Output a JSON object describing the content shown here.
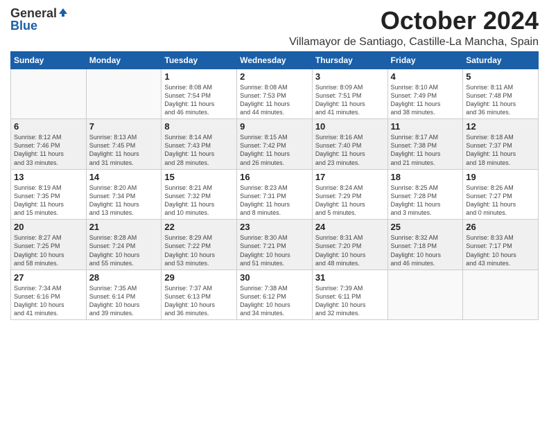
{
  "header": {
    "logo_general": "General",
    "logo_blue": "Blue",
    "month_title": "October 2024",
    "location": "Villamayor de Santiago, Castille-La Mancha, Spain"
  },
  "weekdays": [
    "Sunday",
    "Monday",
    "Tuesday",
    "Wednesday",
    "Thursday",
    "Friday",
    "Saturday"
  ],
  "weeks": [
    [
      {
        "day": "",
        "info": ""
      },
      {
        "day": "",
        "info": ""
      },
      {
        "day": "1",
        "info": "Sunrise: 8:08 AM\nSunset: 7:54 PM\nDaylight: 11 hours\nand 46 minutes."
      },
      {
        "day": "2",
        "info": "Sunrise: 8:08 AM\nSunset: 7:53 PM\nDaylight: 11 hours\nand 44 minutes."
      },
      {
        "day": "3",
        "info": "Sunrise: 8:09 AM\nSunset: 7:51 PM\nDaylight: 11 hours\nand 41 minutes."
      },
      {
        "day": "4",
        "info": "Sunrise: 8:10 AM\nSunset: 7:49 PM\nDaylight: 11 hours\nand 38 minutes."
      },
      {
        "day": "5",
        "info": "Sunrise: 8:11 AM\nSunset: 7:48 PM\nDaylight: 11 hours\nand 36 minutes."
      }
    ],
    [
      {
        "day": "6",
        "info": "Sunrise: 8:12 AM\nSunset: 7:46 PM\nDaylight: 11 hours\nand 33 minutes."
      },
      {
        "day": "7",
        "info": "Sunrise: 8:13 AM\nSunset: 7:45 PM\nDaylight: 11 hours\nand 31 minutes."
      },
      {
        "day": "8",
        "info": "Sunrise: 8:14 AM\nSunset: 7:43 PM\nDaylight: 11 hours\nand 28 minutes."
      },
      {
        "day": "9",
        "info": "Sunrise: 8:15 AM\nSunset: 7:42 PM\nDaylight: 11 hours\nand 26 minutes."
      },
      {
        "day": "10",
        "info": "Sunrise: 8:16 AM\nSunset: 7:40 PM\nDaylight: 11 hours\nand 23 minutes."
      },
      {
        "day": "11",
        "info": "Sunrise: 8:17 AM\nSunset: 7:38 PM\nDaylight: 11 hours\nand 21 minutes."
      },
      {
        "day": "12",
        "info": "Sunrise: 8:18 AM\nSunset: 7:37 PM\nDaylight: 11 hours\nand 18 minutes."
      }
    ],
    [
      {
        "day": "13",
        "info": "Sunrise: 8:19 AM\nSunset: 7:35 PM\nDaylight: 11 hours\nand 15 minutes."
      },
      {
        "day": "14",
        "info": "Sunrise: 8:20 AM\nSunset: 7:34 PM\nDaylight: 11 hours\nand 13 minutes."
      },
      {
        "day": "15",
        "info": "Sunrise: 8:21 AM\nSunset: 7:32 PM\nDaylight: 11 hours\nand 10 minutes."
      },
      {
        "day": "16",
        "info": "Sunrise: 8:23 AM\nSunset: 7:31 PM\nDaylight: 11 hours\nand 8 minutes."
      },
      {
        "day": "17",
        "info": "Sunrise: 8:24 AM\nSunset: 7:29 PM\nDaylight: 11 hours\nand 5 minutes."
      },
      {
        "day": "18",
        "info": "Sunrise: 8:25 AM\nSunset: 7:28 PM\nDaylight: 11 hours\nand 3 minutes."
      },
      {
        "day": "19",
        "info": "Sunrise: 8:26 AM\nSunset: 7:27 PM\nDaylight: 11 hours\nand 0 minutes."
      }
    ],
    [
      {
        "day": "20",
        "info": "Sunrise: 8:27 AM\nSunset: 7:25 PM\nDaylight: 10 hours\nand 58 minutes."
      },
      {
        "day": "21",
        "info": "Sunrise: 8:28 AM\nSunset: 7:24 PM\nDaylight: 10 hours\nand 55 minutes."
      },
      {
        "day": "22",
        "info": "Sunrise: 8:29 AM\nSunset: 7:22 PM\nDaylight: 10 hours\nand 53 minutes."
      },
      {
        "day": "23",
        "info": "Sunrise: 8:30 AM\nSunset: 7:21 PM\nDaylight: 10 hours\nand 51 minutes."
      },
      {
        "day": "24",
        "info": "Sunrise: 8:31 AM\nSunset: 7:20 PM\nDaylight: 10 hours\nand 48 minutes."
      },
      {
        "day": "25",
        "info": "Sunrise: 8:32 AM\nSunset: 7:18 PM\nDaylight: 10 hours\nand 46 minutes."
      },
      {
        "day": "26",
        "info": "Sunrise: 8:33 AM\nSunset: 7:17 PM\nDaylight: 10 hours\nand 43 minutes."
      }
    ],
    [
      {
        "day": "27",
        "info": "Sunrise: 7:34 AM\nSunset: 6:16 PM\nDaylight: 10 hours\nand 41 minutes."
      },
      {
        "day": "28",
        "info": "Sunrise: 7:35 AM\nSunset: 6:14 PM\nDaylight: 10 hours\nand 39 minutes."
      },
      {
        "day": "29",
        "info": "Sunrise: 7:37 AM\nSunset: 6:13 PM\nDaylight: 10 hours\nand 36 minutes."
      },
      {
        "day": "30",
        "info": "Sunrise: 7:38 AM\nSunset: 6:12 PM\nDaylight: 10 hours\nand 34 minutes."
      },
      {
        "day": "31",
        "info": "Sunrise: 7:39 AM\nSunset: 6:11 PM\nDaylight: 10 hours\nand 32 minutes."
      },
      {
        "day": "",
        "info": ""
      },
      {
        "day": "",
        "info": ""
      }
    ]
  ]
}
